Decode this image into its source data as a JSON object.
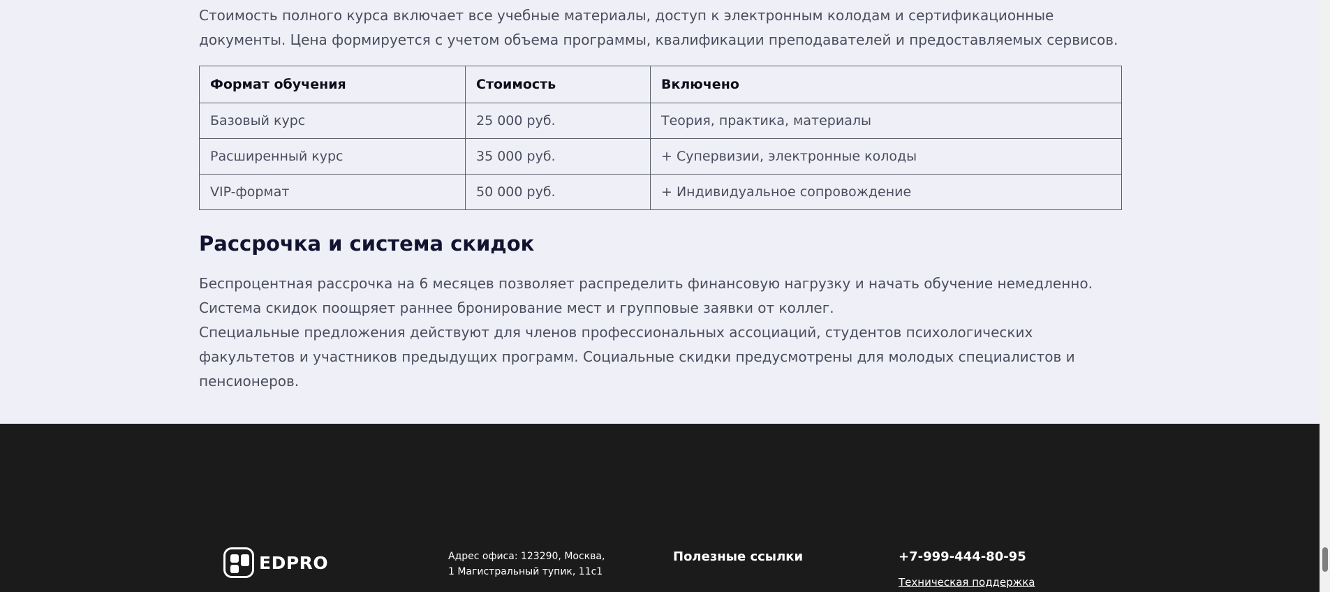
{
  "intro": {
    "text": "Стоимость полного курса включает все учебные материалы, доступ к электронным колодам и сертификационные документы. Цена формируется с учетом объема программы, квалификации преподавателей и предоставляемых сервисов."
  },
  "price_table": {
    "headers": [
      "Формат обучения",
      "Стоимость",
      "Включено"
    ],
    "rows": [
      [
        "Базовый курс",
        "25 000 руб.",
        "Теория, практика, материалы"
      ],
      [
        "Расширенный курс",
        "35 000 руб.",
        "+ Супервизии, электронные колоды"
      ],
      [
        "VIP-формат",
        "50 000 руб.",
        "+ Индивидуальное сопровождение"
      ]
    ]
  },
  "section": {
    "title": "Рассрочка и система скидок",
    "paragraph1": "Беспроцентная рассрочка на 6 месяцев позволяет распределить финансовую нагрузку и начать обучение немедленно. Система скидок поощряет раннее бронирование мест и групповые заявки от коллег.",
    "paragraph2": "Специальные предложения действуют для членов профессиональных ассоциаций, студентов психологических факультетов и участников предыдущих программ. Социальные скидки предусмотрены для молодых специалистов и пенсионеров."
  },
  "footer": {
    "logo_text": "EDPRO",
    "address": "Адрес офиса: 123290, Москва, 1 Магистральный тупик, 11с1",
    "links_title": "Полезные ссылки",
    "phone": "+7-999-444-80-95",
    "support_link": "Техническая поддержка"
  },
  "colors": {
    "content_bg": "#eff0f7",
    "footer_bg": "#1b1b1c",
    "heading": "#121330",
    "body_text": "#4a4d5e"
  }
}
